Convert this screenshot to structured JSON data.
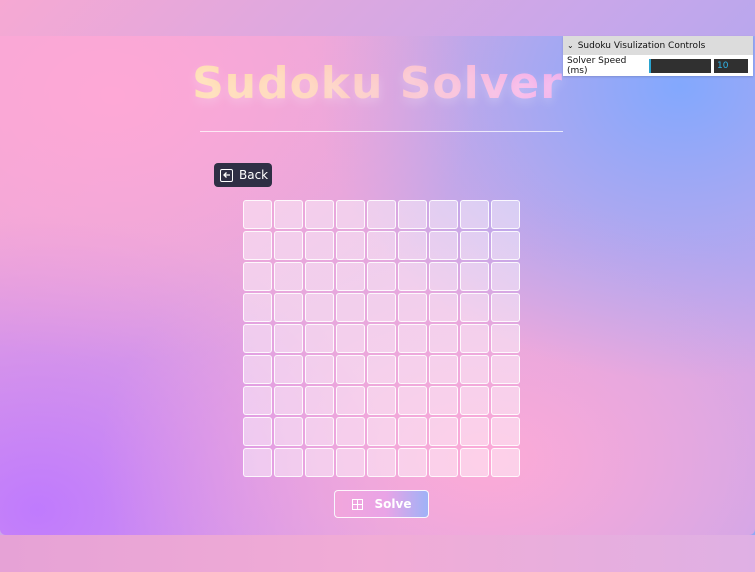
{
  "app": {
    "title": "Sudoku Solver",
    "back_label": "Back",
    "solve_label": "Solve"
  },
  "controls": {
    "header": "Sudoku Visulization Controls",
    "speed_label": "Solver Speed (ms)",
    "speed_value": "10",
    "speed_fraction": 0.02
  },
  "board": {
    "rows": [
      [
        "",
        "",
        "",
        "",
        "",
        "",
        "",
        "",
        ""
      ],
      [
        "",
        "",
        "",
        "",
        "",
        "",
        "",
        "",
        ""
      ],
      [
        "",
        "",
        "",
        "",
        "",
        "",
        "",
        "",
        ""
      ],
      [
        "",
        "",
        "",
        "",
        "",
        "",
        "",
        "",
        ""
      ],
      [
        "",
        "",
        "",
        "",
        "",
        "",
        "",
        "",
        ""
      ],
      [
        "",
        "",
        "",
        "",
        "",
        "",
        "",
        "",
        ""
      ],
      [
        "",
        "",
        "",
        "",
        "",
        "",
        "",
        "",
        ""
      ],
      [
        "",
        "",
        "",
        "",
        "",
        "",
        "",
        "",
        ""
      ],
      [
        "",
        "",
        "",
        "",
        "",
        "",
        "",
        "",
        ""
      ]
    ]
  },
  "icons": {
    "back": "back-arrow-icon",
    "solve": "grid-icon",
    "collapse": "chevron-down-icon"
  },
  "colors": {
    "button_dark": "#2f2f45",
    "accent_blue": "#2eb5ea"
  }
}
